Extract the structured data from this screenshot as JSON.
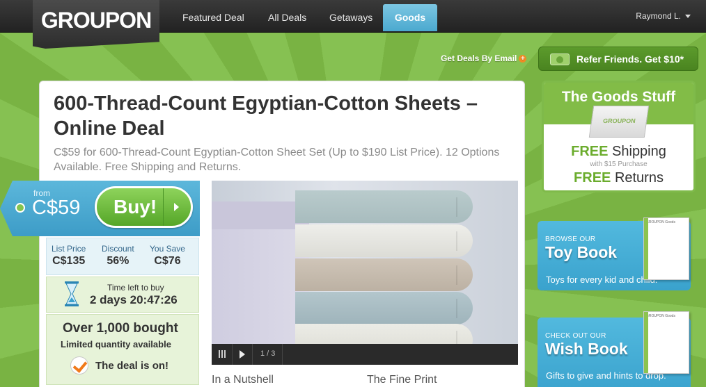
{
  "brand": {
    "logo_text": "GROUPON"
  },
  "nav": {
    "items": [
      "Featured Deal",
      "All Deals",
      "Getaways",
      "Goods"
    ],
    "active": "Goods",
    "user": "Raymond L."
  },
  "header_links": {
    "deals_by_email": "Get Deals By Email",
    "refer": "Refer Friends. Get $10*"
  },
  "deal": {
    "title": "600-Thread-Count Egyptian-Cotton Sheets – Online Deal",
    "subtitle": "C$59 for 600-Thread-Count Egyptian-Cotton Sheet Set (Up to $190 List Price). 12 Options Available. Free Shipping and Returns.",
    "from_label": "from",
    "price": "C$59",
    "buy_label": "Buy!",
    "stats": [
      {
        "label": "List Price",
        "value": "C$135"
      },
      {
        "label": "Discount",
        "value": "56%"
      },
      {
        "label": "You Save",
        "value": "C$76"
      }
    ],
    "time_left_label": "Time left to buy",
    "time_left": "2 days 20:47:26",
    "bought_title": "Over 1,000 bought",
    "bought_sub": "Limited quantity available",
    "deal_status": "The deal is on!",
    "photo_counter": "1 / 3",
    "tabs": [
      "In a Nutshell",
      "The Fine Print"
    ]
  },
  "sidebar": {
    "goods": {
      "title": "The Goods Stuff",
      "free1": "FREE",
      "shipping": "Shipping",
      "with_purchase": "with $15 Purchase",
      "free2": "FREE",
      "returns": "Returns"
    },
    "toy": {
      "small": "BROWSE OUR",
      "big": "Toy Book",
      "desc": "Toys for every kid and child.",
      "book_head": "GROUPON Goods"
    },
    "wish": {
      "small": "CHECK OUT OUR",
      "big": "Wish Book",
      "desc": "Gifts to give and hints to drop.",
      "book_head": "GROUPON Goods"
    }
  },
  "colors": {
    "accent_blue": "#4ba9cf",
    "buy_green": "#55a628",
    "sidebar_green": "#82bc47",
    "check_orange": "#f07a1a"
  }
}
